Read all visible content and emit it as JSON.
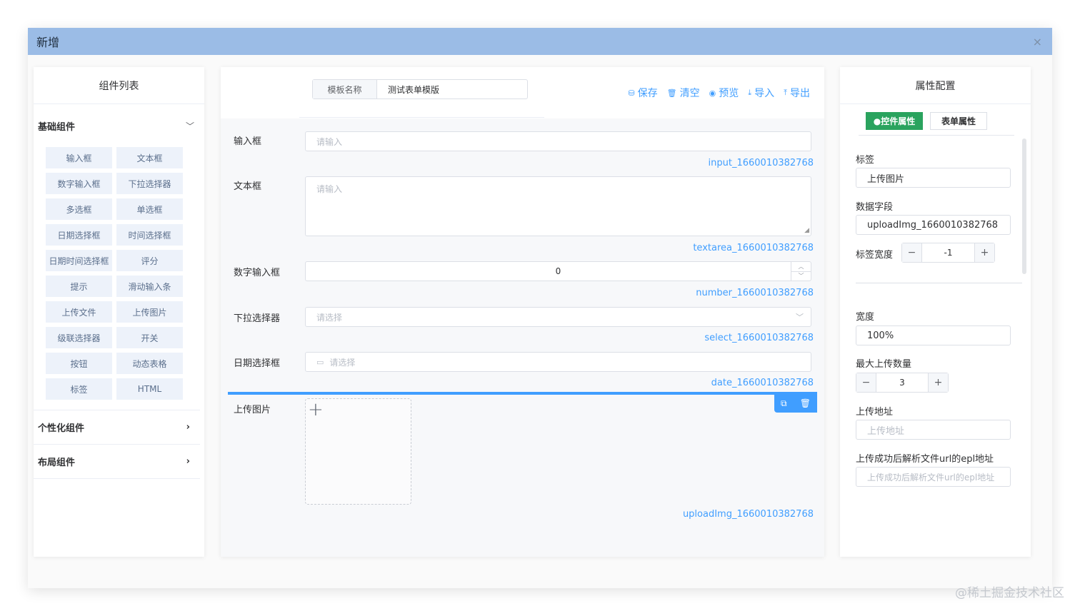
{
  "dialog": {
    "title": "新增",
    "close": "×"
  },
  "left": {
    "title": "组件列表",
    "basic_group": "基础组件",
    "components": [
      "输入框",
      "文本框",
      "数字输入框",
      "下拉选择器",
      "多选框",
      "单选框",
      "日期选择框",
      "时间选择框",
      "日期时间选择框",
      "评分",
      "提示",
      "滑动输入条",
      "上传文件",
      "上传图片",
      "级联选择器",
      "开关",
      "按钮",
      "动态表格",
      "标签",
      "HTML"
    ],
    "custom_group": "个性化组件",
    "layout_group": "布局组件"
  },
  "center": {
    "template_label": "模板名称",
    "template_value": "测试表单模版",
    "toolbar": {
      "save": "保存",
      "clear": "清空",
      "preview": "预览",
      "import": "导入",
      "export": "导出"
    },
    "fields": {
      "input": {
        "label": "输入框",
        "placeholder": "请输入",
        "id": "input_1660010382768"
      },
      "textarea": {
        "label": "文本框",
        "placeholder": "请输入",
        "id": "textarea_1660010382768"
      },
      "number": {
        "label": "数字输入框",
        "value": "0",
        "id": "number_1660010382768"
      },
      "select": {
        "label": "下拉选择器",
        "placeholder": "请选择",
        "id": "select_1660010382768"
      },
      "date": {
        "label": "日期选择框",
        "placeholder": "请选择",
        "id": "date_1660010382768"
      },
      "upload": {
        "label": "上传图片",
        "id": "uploadImg_1660010382768"
      }
    }
  },
  "right": {
    "title": "属性配置",
    "tab_active": "●控件属性",
    "tab_other": "表单属性",
    "label_label": "标签",
    "label_value": "上传图片",
    "field_label": "数据字段",
    "field_value": "uploadImg_1660010382768",
    "label_width_label": "标签宽度",
    "label_width_value": "-1",
    "width_label": "宽度",
    "width_value": "100%",
    "max_upload_label": "最大上传数量",
    "max_upload_value": "3",
    "upload_url_label": "上传地址",
    "upload_url_placeholder": "上传地址",
    "parse_url_label": "上传成功后解析文件url的epl地址",
    "parse_url_placeholder": "上传成功后解析文件url的epl地址"
  },
  "watermark": "@稀土掘金技术社区"
}
